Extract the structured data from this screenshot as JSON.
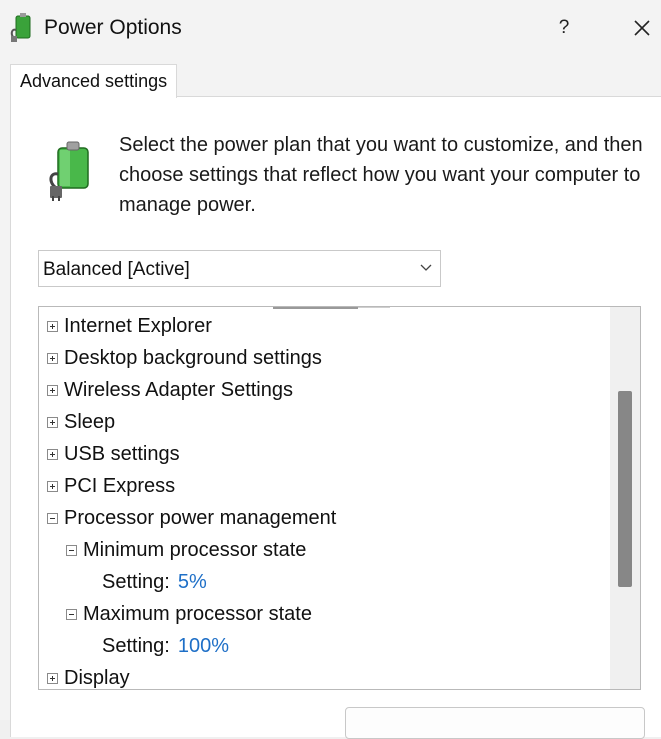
{
  "window": {
    "title": "Power Options",
    "help_glyph": "?",
    "close_icon": "close-icon",
    "app_icon": "power-battery-icon"
  },
  "tab": {
    "label": "Advanced settings"
  },
  "description": "Select the power plan that you want to customize, and then choose settings that reflect how you want your computer to manage power.",
  "plan_dropdown": {
    "selected": "Balanced [Active]"
  },
  "tree": {
    "items": [
      {
        "label": "Internet Explorer",
        "state": "collapsed",
        "level": 0
      },
      {
        "label": "Desktop background settings",
        "state": "collapsed",
        "level": 0
      },
      {
        "label": "Wireless Adapter Settings",
        "state": "collapsed",
        "level": 0
      },
      {
        "label": "Sleep",
        "state": "collapsed",
        "level": 0
      },
      {
        "label": "USB settings",
        "state": "collapsed",
        "level": 0
      },
      {
        "label": "PCI Express",
        "state": "collapsed",
        "level": 0
      },
      {
        "label": "Processor power management",
        "state": "expanded",
        "level": 0
      },
      {
        "label": "Minimum processor state",
        "state": "expanded",
        "level": 1
      },
      {
        "label": "Setting:",
        "value": "5%",
        "level": 2
      },
      {
        "label": "Maximum processor state",
        "state": "expanded",
        "level": 1
      },
      {
        "label": "Setting:",
        "value": "100%",
        "level": 2
      },
      {
        "label": "Display",
        "state": "collapsed",
        "level": 0
      }
    ]
  },
  "colors": {
    "accent_value": "#1e6fc7",
    "window_bg": "#f3f3f3",
    "scroll_thumb": "#878787"
  }
}
